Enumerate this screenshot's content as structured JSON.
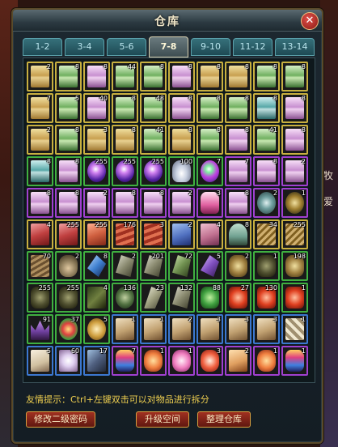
{
  "window": {
    "title": "仓库",
    "close_label": "✕"
  },
  "tabs": [
    "1-2",
    "3-4",
    "5-6",
    "7-8",
    "9-10",
    "11-12",
    "13-14"
  ],
  "active_tab": 3,
  "side_text": [
    "牧",
    "爱"
  ],
  "hint": "友情提示：Ctrl+左键双击可以对物品进行拆分",
  "buttons": {
    "change_password": "修改二级密码",
    "upgrade_space": "升级空间",
    "sort_storage": "整理仓库"
  },
  "colors": {
    "tab_active": "#6a7a7e",
    "tab": "#1e4a54",
    "button": "#a03020",
    "hint": "#f0d050"
  },
  "border_colors": {
    "gold": "#c8b040",
    "green": "#40b040",
    "purple": "#a040d0",
    "blue": "#3c78d0"
  },
  "slots": [
    {
      "icon": "scroll-yellow",
      "border": "gold",
      "qty": "2"
    },
    {
      "icon": "scroll-green",
      "border": "gold",
      "qty": "8"
    },
    {
      "icon": "scroll-pink",
      "border": "gold",
      "qty": "8"
    },
    {
      "icon": "scroll-green",
      "border": "gold",
      "qty": "44"
    },
    {
      "icon": "scroll-green",
      "border": "gold",
      "qty": "8"
    },
    {
      "icon": "scroll-pink",
      "border": "gold",
      "qty": "8"
    },
    {
      "icon": "scroll-yellow",
      "border": "gold",
      "qty": "8"
    },
    {
      "icon": "scroll-yellow",
      "border": "gold",
      "qty": "8"
    },
    {
      "icon": "scroll-green",
      "border": "gold",
      "qty": "8"
    },
    {
      "icon": "scroll-green",
      "border": "gold",
      "qty": "8"
    },
    {
      "icon": "scroll-yellow",
      "border": "gold",
      "qty": "7"
    },
    {
      "icon": "scroll-green",
      "border": "gold",
      "qty": "5"
    },
    {
      "icon": "scroll-pink",
      "border": "gold",
      "qty": "40"
    },
    {
      "icon": "scroll-green",
      "border": "gold",
      "qty": "8"
    },
    {
      "icon": "scroll-green",
      "border": "gold",
      "qty": "48"
    },
    {
      "icon": "scroll-pink",
      "border": "gold",
      "qty": "8"
    },
    {
      "icon": "scroll-green",
      "border": "gold",
      "qty": "8"
    },
    {
      "icon": "scroll-green",
      "border": "gold",
      "qty": "8"
    },
    {
      "icon": "scroll-teal",
      "border": "gold",
      "qty": "8"
    },
    {
      "icon": "scroll-pink",
      "border": "gold",
      "qty": "8"
    },
    {
      "icon": "scroll-yellow",
      "border": "gold",
      "qty": "2"
    },
    {
      "icon": "scroll-green",
      "border": "gold",
      "qty": "8"
    },
    {
      "icon": "scroll-yellow",
      "border": "gold",
      "qty": "3"
    },
    {
      "icon": "scroll-yellow",
      "border": "gold",
      "qty": "8"
    },
    {
      "icon": "scroll-green",
      "border": "gold",
      "qty": "41"
    },
    {
      "icon": "scroll-yellow",
      "border": "gold",
      "qty": "8"
    },
    {
      "icon": "scroll-green",
      "border": "gold",
      "qty": "8"
    },
    {
      "icon": "scroll-pink",
      "border": "gold",
      "qty": "8"
    },
    {
      "icon": "scroll-green",
      "border": "gold",
      "qty": "41"
    },
    {
      "icon": "scroll-pink",
      "border": "gold",
      "qty": "8"
    },
    {
      "icon": "scroll-teal",
      "border": "green",
      "qty": "8"
    },
    {
      "icon": "scroll-pink",
      "border": "green",
      "qty": "8"
    },
    {
      "icon": "orb-purple",
      "border": "green",
      "qty": "255"
    },
    {
      "icon": "orb-purple",
      "border": "green",
      "qty": "255"
    },
    {
      "icon": "orb-purple",
      "border": "green",
      "qty": "255"
    },
    {
      "icon": "vase",
      "border": "green",
      "qty": "100"
    },
    {
      "icon": "orb-multi",
      "border": "green",
      "qty": "7"
    },
    {
      "icon": "scroll-pink",
      "border": "purple",
      "qty": "7"
    },
    {
      "icon": "scroll-pink",
      "border": "purple",
      "qty": "8"
    },
    {
      "icon": "scroll-pink",
      "border": "purple",
      "qty": "2"
    },
    {
      "icon": "scroll-pink",
      "border": "purple",
      "qty": "8"
    },
    {
      "icon": "scroll-pink",
      "border": "purple",
      "qty": "8"
    },
    {
      "icon": "scroll-pink",
      "border": "purple",
      "qty": "2"
    },
    {
      "icon": "scroll-pink",
      "border": "purple",
      "qty": "8"
    },
    {
      "icon": "scroll-pink",
      "border": "purple",
      "qty": "8"
    },
    {
      "icon": "scroll-pink",
      "border": "purple",
      "qty": "2"
    },
    {
      "icon": "bottle-pink",
      "border": "purple",
      "qty": "3"
    },
    {
      "icon": "scroll-pink",
      "border": "purple",
      "qty": "8"
    },
    {
      "icon": "spiral",
      "border": "purple",
      "qty": "2"
    },
    {
      "icon": "taiji",
      "border": "purple",
      "qty": "1"
    },
    {
      "icon": "book-red",
      "border": "gold",
      "qty": "4"
    },
    {
      "icon": "book-red",
      "border": "gold",
      "qty": "255"
    },
    {
      "icon": "cloth-red",
      "border": "gold",
      "qty": "255"
    },
    {
      "icon": "tiles-red",
      "border": "gold",
      "qty": "176"
    },
    {
      "icon": "tiles-red",
      "border": "gold",
      "qty": "3"
    },
    {
      "icon": "cloth-blue",
      "border": "gold",
      "qty": "2"
    },
    {
      "icon": "cloth-pink",
      "border": "gold",
      "qty": "4"
    },
    {
      "icon": "hat",
      "border": "gold",
      "qty": "8"
    },
    {
      "icon": "bundle",
      "border": "gold",
      "qty": "34"
    },
    {
      "icon": "bundle",
      "border": "gold",
      "qty": "255"
    },
    {
      "icon": "wood",
      "border": "green",
      "qty": "70"
    },
    {
      "icon": "pouch",
      "border": "green",
      "qty": "2"
    },
    {
      "icon": "crystal-blue",
      "border": "green",
      "qty": "8"
    },
    {
      "icon": "stone-gray",
      "border": "green",
      "qty": "2"
    },
    {
      "icon": "stone-gray",
      "border": "green",
      "qty": "201"
    },
    {
      "icon": "stone-green",
      "border": "green",
      "qty": "72"
    },
    {
      "icon": "gem-purple",
      "border": "green",
      "qty": "5"
    },
    {
      "icon": "ore-gold",
      "border": "green",
      "qty": "2"
    },
    {
      "icon": "cluster-dark",
      "border": "green",
      "qty": "1"
    },
    {
      "icon": "ore-gold",
      "border": "green",
      "qty": "198"
    },
    {
      "icon": "cluster-dark",
      "border": "green",
      "qty": "255"
    },
    {
      "icon": "cluster-dark",
      "border": "green",
      "qty": "255"
    },
    {
      "icon": "branch",
      "border": "green",
      "qty": "4"
    },
    {
      "icon": "pearl-dark",
      "border": "green",
      "qty": "136"
    },
    {
      "icon": "feather",
      "border": "green",
      "qty": "23"
    },
    {
      "icon": "stone-gray",
      "border": "green",
      "qty": "132"
    },
    {
      "icon": "cluster-green",
      "border": "green",
      "qty": "88"
    },
    {
      "icon": "coral-red",
      "border": "green",
      "qty": "27"
    },
    {
      "icon": "coral-red",
      "border": "green",
      "qty": "130"
    },
    {
      "icon": "coral-red",
      "border": "green",
      "qty": "1"
    },
    {
      "icon": "crown-purple",
      "border": "green",
      "qty": "91"
    },
    {
      "icon": "flower-red",
      "border": "green",
      "qty": "37"
    },
    {
      "icon": "coin",
      "border": "green",
      "qty": "5"
    },
    {
      "icon": "book-tan",
      "border": "blue",
      "qty": "1"
    },
    {
      "icon": "book-tan",
      "border": "blue",
      "qty": "1"
    },
    {
      "icon": "book-tan",
      "border": "blue",
      "qty": "2"
    },
    {
      "icon": "book-tan",
      "border": "blue",
      "qty": "3"
    },
    {
      "icon": "book-tan",
      "border": "blue",
      "qty": "3"
    },
    {
      "icon": "book-tan",
      "border": "blue",
      "qty": "3"
    },
    {
      "icon": "rolls",
      "border": "blue",
      "qty": "1"
    },
    {
      "icon": "paper",
      "border": "blue",
      "qty": "5"
    },
    {
      "icon": "seal",
      "border": "blue",
      "qty": "60"
    },
    {
      "icon": "hammer",
      "border": "blue",
      "qty": "17"
    },
    {
      "icon": "vase-rainbow",
      "border": "purple",
      "qty": "7"
    },
    {
      "icon": "fruit",
      "border": "purple",
      "qty": "1"
    },
    {
      "icon": "gem-pink",
      "border": "purple",
      "qty": "1"
    },
    {
      "icon": "gem-red",
      "border": "purple",
      "qty": "3"
    },
    {
      "icon": "book-orange",
      "border": "purple",
      "qty": "2"
    },
    {
      "icon": "fruit",
      "border": "purple",
      "qty": "1"
    },
    {
      "icon": "vase-rainbow",
      "border": "purple",
      "qty": "1"
    }
  ]
}
